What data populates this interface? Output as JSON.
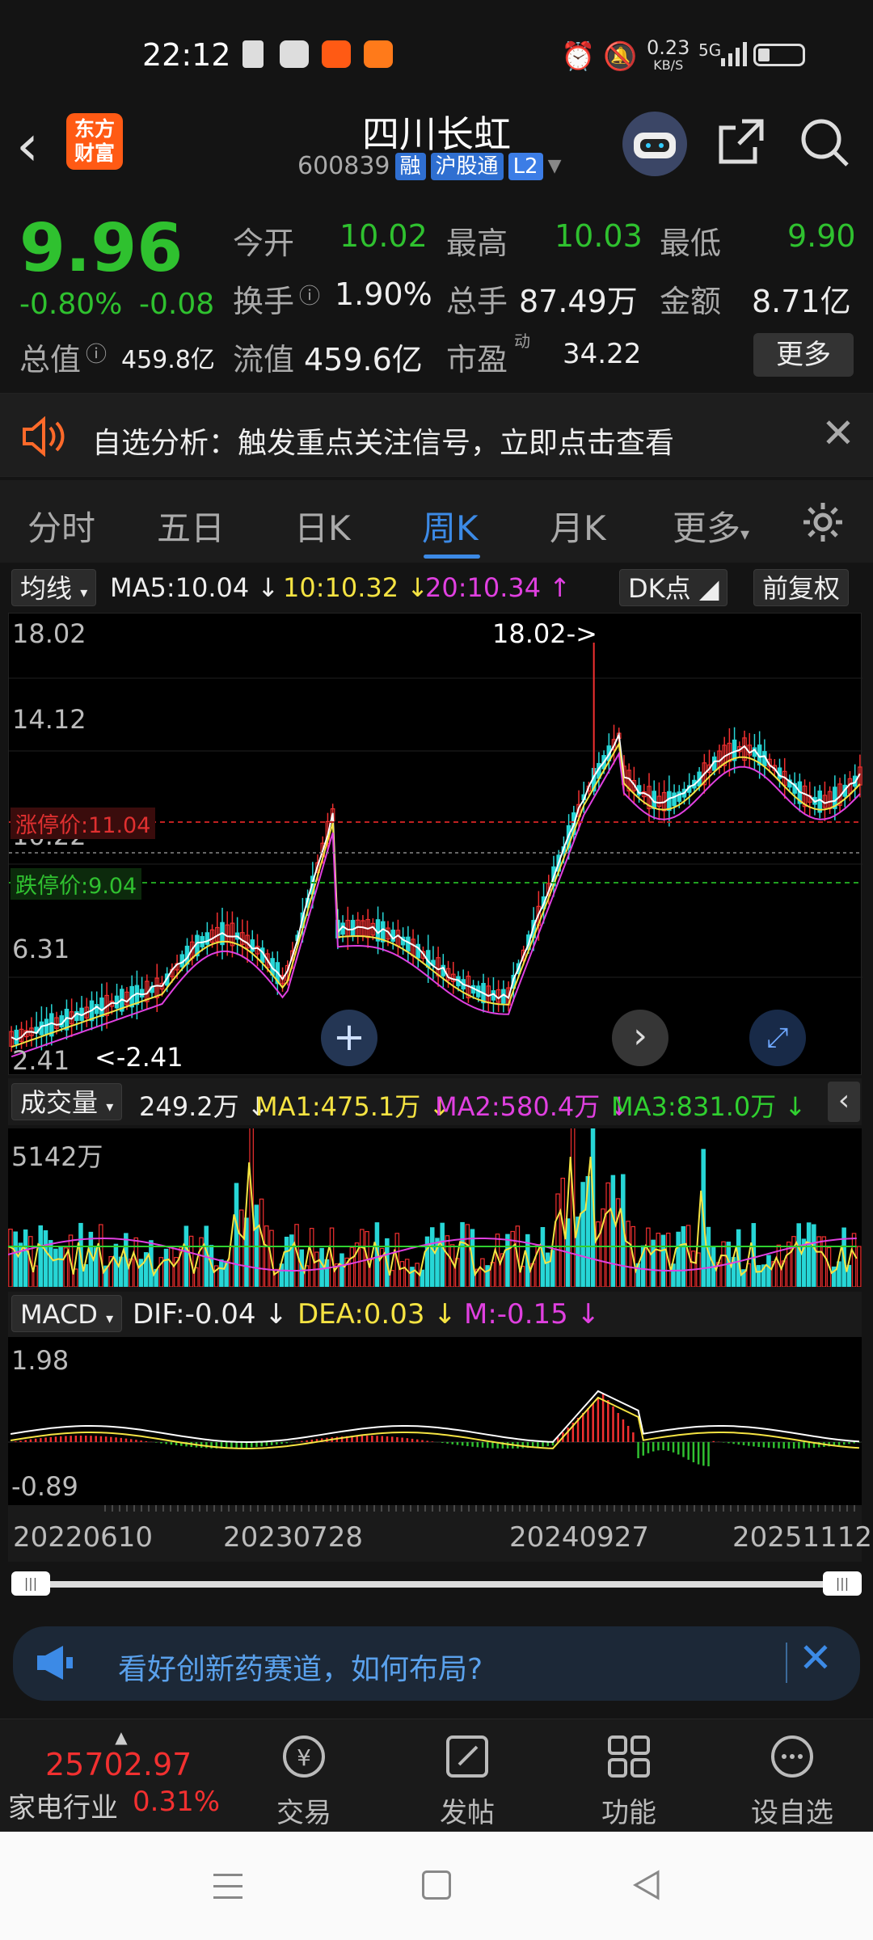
{
  "status_bar": {
    "time": "22:12",
    "net_speed": "0.23",
    "net_unit": "KB/S",
    "signal": "5G"
  },
  "header": {
    "logo_line1": "东方",
    "logo_line2": "财富",
    "stock_name": "四川长虹",
    "stock_code": "600839",
    "tags": [
      "融",
      "沪股通",
      "L2"
    ]
  },
  "quote": {
    "price": "9.96",
    "change_pct": "-0.80%",
    "change_amt": "-0.08",
    "open_label": "今开",
    "open_value": "10.02",
    "high_label": "最高",
    "high_value": "10.03",
    "low_label": "最低",
    "low_value": "9.90",
    "turnover_label": "换手",
    "turnover_value": "1.90%",
    "volume_label": "总手",
    "volume_value": "87.49万",
    "amount_label": "金额",
    "amount_value": "8.71亿",
    "mktcap_label": "总值",
    "mktcap_value": "459.8亿",
    "float_label": "流值",
    "float_value": "459.6亿",
    "pe_label": "市盈",
    "pe_sup": "动",
    "pe_value": "34.22",
    "more_button": "更多"
  },
  "alert": {
    "text": "自选分析：触发重点关注信号，立即点击查看"
  },
  "tabs": [
    {
      "label": "分时",
      "active": false
    },
    {
      "label": "五日",
      "active": false
    },
    {
      "label": "日K",
      "active": false
    },
    {
      "label": "周K",
      "active": true
    },
    {
      "label": "月K",
      "active": false
    },
    {
      "label": "更多",
      "active": false
    }
  ],
  "ma_bar": {
    "indicator": "均线",
    "ma5": "MA5:10.04",
    "ma10": "10:10.32",
    "ma20": "20:10.34",
    "dk_button": "DK点",
    "adjust_button": "前复权"
  },
  "kline": {
    "y_labels": [
      "18.02",
      "14.12",
      "10.22",
      "6.31",
      "2.41"
    ],
    "limit_up": "涨停价:11.04",
    "limit_down": "跌停价:9.04",
    "max_marker": "18.02->",
    "min_marker": "<-2.41"
  },
  "volume": {
    "indicator": "成交量",
    "value": "249.2万",
    "ma1": "MA1:475.1万",
    "ma2": "MA2:580.4万",
    "ma3": "MA3:831.0万",
    "y_label": "5142万"
  },
  "macd": {
    "indicator": "MACD",
    "dif": "DIF:-0.04",
    "dea": "DEA:0.03",
    "m": "M:-0.15",
    "y_top": "1.98",
    "y_bottom": "-0.89"
  },
  "dates": [
    "20220610",
    "20230728",
    "20240927",
    "20251112"
  ],
  "ad": {
    "text": "看好创新药赛道，如何布局?"
  },
  "bottom_nav": {
    "index_value": "25702.97",
    "index_name": "家电行业",
    "index_change": "0.31%",
    "items": [
      "交易",
      "发帖",
      "功能",
      "设自选"
    ]
  },
  "colors": {
    "up": "#f23030",
    "down": "#2fc12f",
    "accent": "#3c8ae6",
    "ma5": "#ffffff",
    "ma10": "#f5e342",
    "ma20": "#e040e0"
  }
}
